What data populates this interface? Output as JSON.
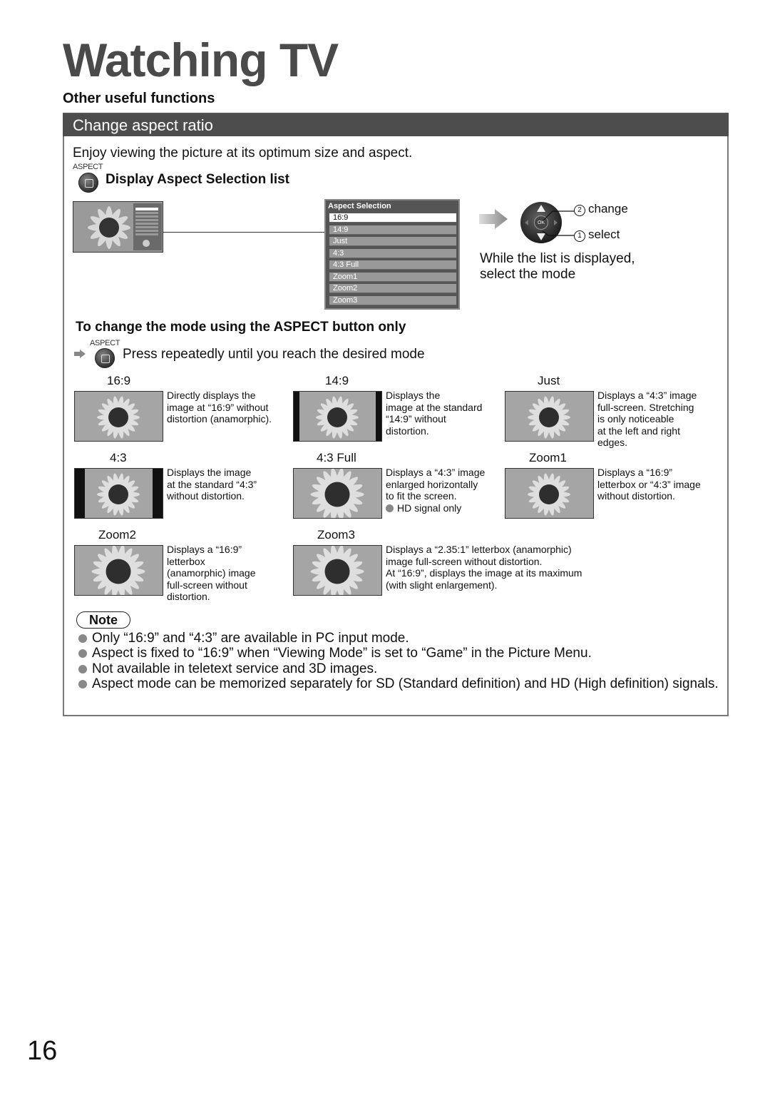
{
  "page": {
    "title": "Watching TV",
    "subtitle": "Other useful functions",
    "page_number": "16"
  },
  "section": {
    "heading": "Change aspect ratio",
    "intro": "Enjoy viewing the picture at its optimum size and aspect.",
    "button_label": "ASPECT",
    "step_heading": "Display Aspect Selection list"
  },
  "aspect_menu": {
    "title": "Aspect Selection",
    "selected": "16:9",
    "items": [
      "16:9",
      "14:9",
      "Just",
      "4:3",
      "4:3 Full",
      "Zoom1",
      "Zoom2",
      "Zoom3"
    ]
  },
  "navigation": {
    "ok_label": "OK",
    "step2": {
      "num": "2",
      "label": "change"
    },
    "step1": {
      "num": "1",
      "label": "select"
    },
    "instruction_line1": "While the list is displayed,",
    "instruction_line2": "select the mode"
  },
  "aspect_only": {
    "heading": "To change the mode using the ASPECT button only",
    "button_label": "ASPECT",
    "instruction": "Press repeatedly until you reach the desired mode"
  },
  "modes": [
    {
      "name": "16:9",
      "desc": [
        "Directly displays the",
        "image at “16:9” without",
        "distortion (anamorphic)."
      ]
    },
    {
      "name": "14:9",
      "desc": [
        "Displays the",
        "image at the standard",
        "“14:9” without",
        "distortion."
      ]
    },
    {
      "name": "Just",
      "desc": [
        "Displays a “4:3” image",
        "full-screen. Stretching",
        "is only noticeable",
        "at the left and right",
        "edges."
      ]
    },
    {
      "name": "4:3",
      "desc": [
        "Displays the image",
        "at the standard “4:3”",
        "without distortion."
      ]
    },
    {
      "name": "4:3 Full",
      "desc": [
        "Displays a “4:3” image",
        "enlarged horizontally",
        "to fit the screen."
      ],
      "note": "HD signal only"
    },
    {
      "name": "Zoom1",
      "desc": [
        "Displays a “16:9”",
        "letterbox or “4:3” image",
        "without distortion."
      ]
    },
    {
      "name": "Zoom2",
      "desc": [
        "Displays a “16:9”",
        "letterbox",
        "(anamorphic) image",
        "full-screen without",
        "distortion."
      ]
    },
    {
      "name": "Zoom3",
      "desc": [
        "Displays a “2.35:1” letterbox (anamorphic)",
        "image full-screen without distortion.",
        "At “16:9”, displays the image at its maximum",
        "(with slight enlargement)."
      ]
    }
  ],
  "note": {
    "label": "Note",
    "items": [
      "Only “16:9” and “4:3” are available in PC input mode.",
      "Aspect is fixed to “16:9” when “Viewing Mode” is set to “Game” in the Picture Menu.",
      "Not available in teletext service and 3D images.",
      "Aspect mode can be memorized separately for SD (Standard definition) and HD (High definition) signals."
    ]
  },
  "colors": {
    "header_bar": "#4d4d4d",
    "title_gray": "#4a4a4a",
    "bullet_gray": "#888888"
  }
}
